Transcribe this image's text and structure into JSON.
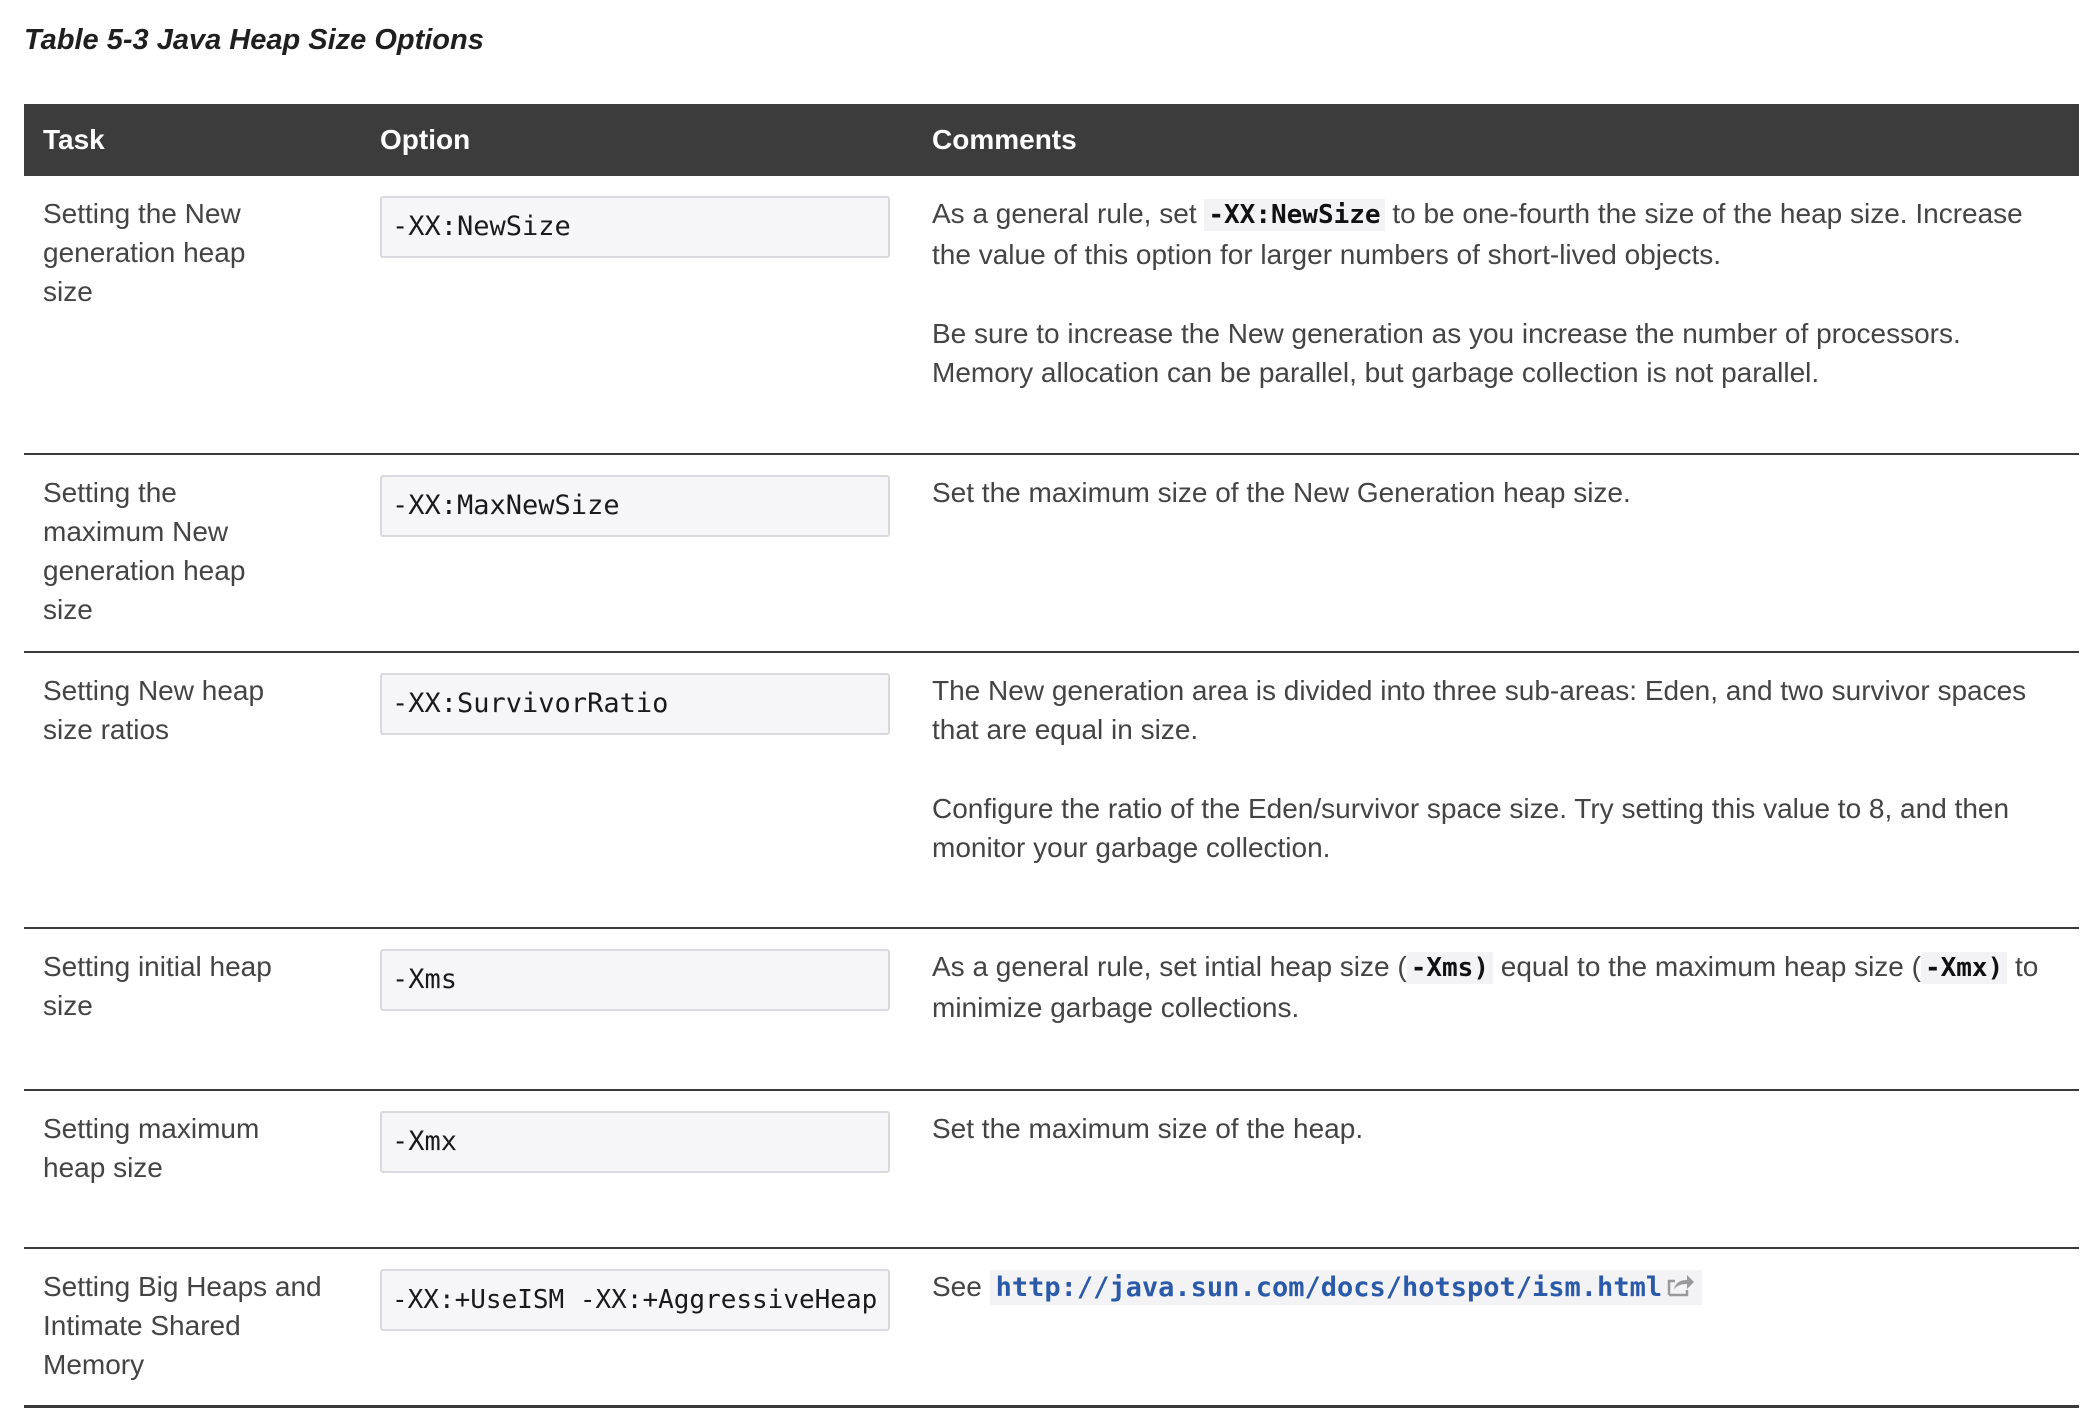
{
  "caption": "Table 5-3 Java Heap Size Options",
  "columns": {
    "task": "Task",
    "option": "Option",
    "comments": "Comments"
  },
  "rows": [
    {
      "task": "Setting the New generation heap size",
      "option": "-XX:NewSize",
      "c1_before": "As a general rule, set ",
      "c1_code": "-XX:NewSize",
      "c1_after": " to be one-fourth the size of the heap size. Increase the value of this option for larger numbers of short-lived objects.",
      "c2": "Be sure to increase the New generation as you increase the number of processors. Memory allocation can be parallel, but garbage collection is not parallel."
    },
    {
      "task": "Setting the maximum New generation heap size",
      "option": "-XX:MaxNewSize",
      "c1": "Set the maximum size of the New Generation heap size."
    },
    {
      "task": "Setting New heap size ratios",
      "option": "-XX:SurvivorRatio",
      "c1": "The New generation area is divided into three sub-areas: Eden, and two survivor spaces that are equal in size.",
      "c2": "Configure the ratio of the Eden/survivor space size. Try setting this value to 8, and then monitor your garbage collection."
    },
    {
      "task": "Setting initial heap size",
      "option": "-Xms",
      "c1_a": "As a general rule, set intial heap size (",
      "c1_code1": "-Xms)",
      "c1_b": " equal to the maximum heap size (",
      "c1_code2": "-Xmx)",
      "c1_c": " to minimize garbage collections."
    },
    {
      "task": "Setting maximum heap size",
      "option": "-Xmx",
      "c1": "Set the maximum size of the heap."
    },
    {
      "task": "Setting Big Heaps and Intimate Shared Memory",
      "option": "-XX:+UseISM -XX:+AggressiveHeap",
      "c1_see": "See ",
      "c1_link": "http://java.sun.com/docs/hotspot/ism.html",
      "c1_icon": "external-link-icon"
    }
  ]
}
